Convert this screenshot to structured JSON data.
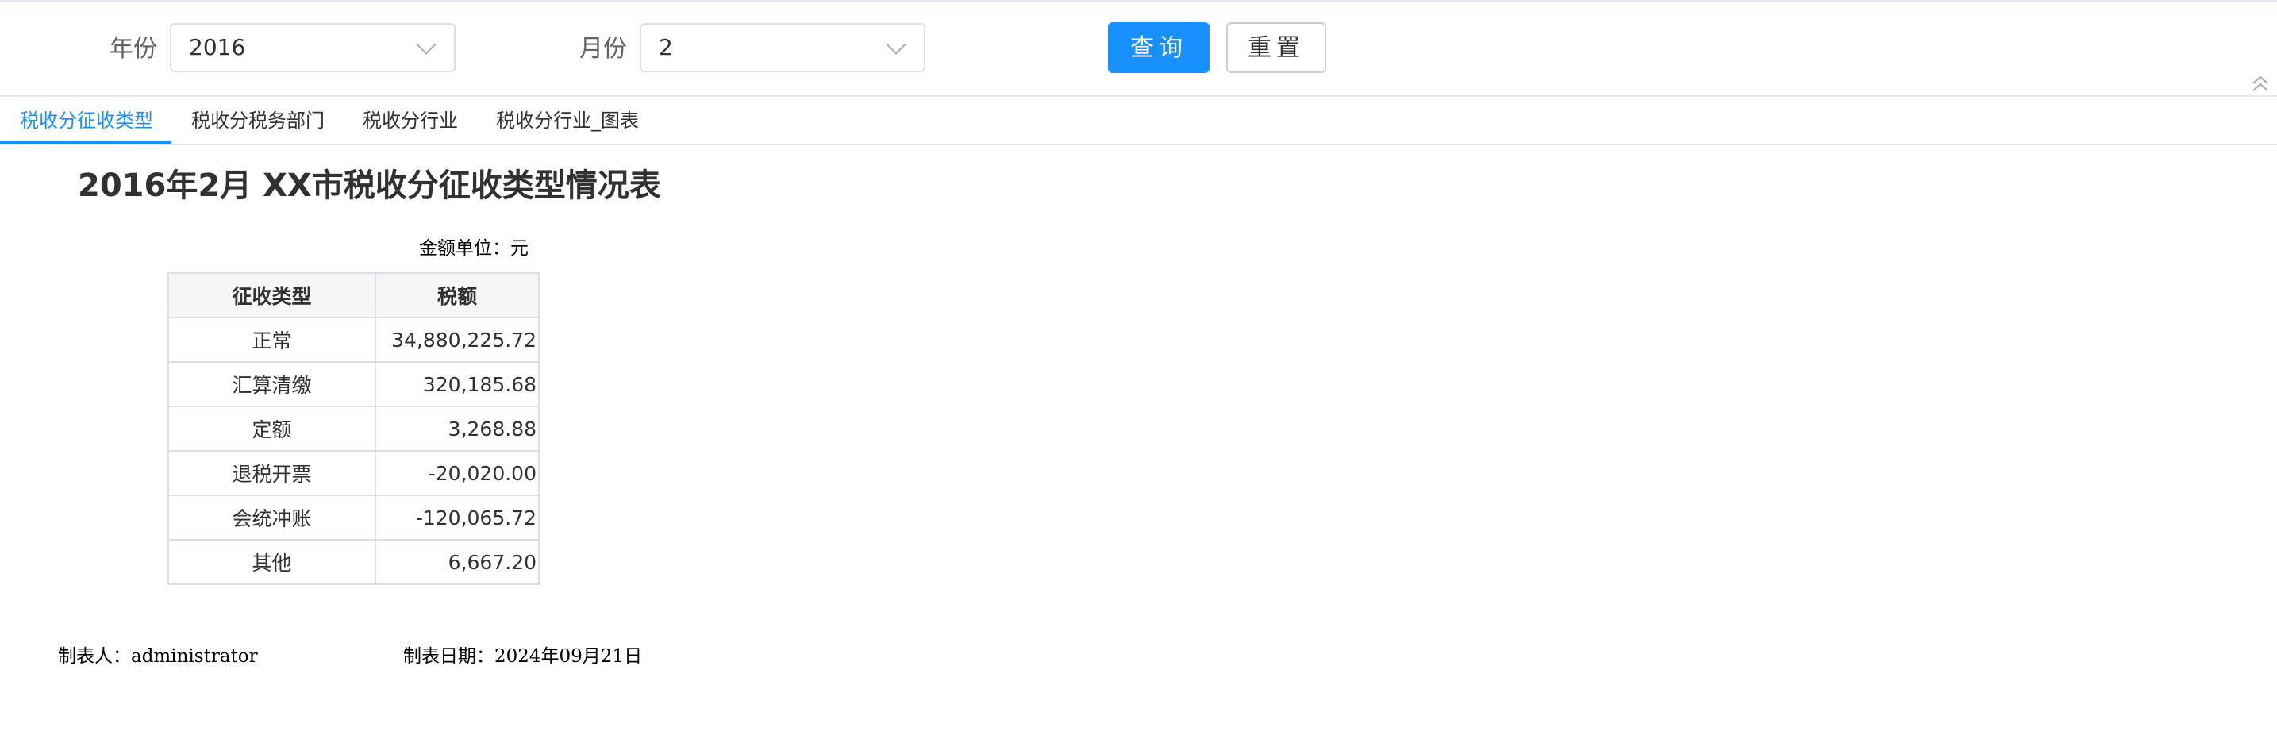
{
  "filters": {
    "year_label": "年份",
    "year_value": "2016",
    "month_label": "月份",
    "month_value": "2",
    "query_button": "查询",
    "reset_button": "重置"
  },
  "tabs": [
    {
      "label": "税收分征收类型",
      "active": true
    },
    {
      "label": "税收分税务部门",
      "active": false
    },
    {
      "label": "税收分行业",
      "active": false
    },
    {
      "label": "税收分行业_图表",
      "active": false
    }
  ],
  "report": {
    "title": "2016年2月 XX市税收分征收类型情况表",
    "unit_note": "金额单位：元",
    "columns": [
      "征收类型",
      "税额"
    ],
    "rows": [
      {
        "type": "正常",
        "amount": "34,880,225.72"
      },
      {
        "type": "汇算清缴",
        "amount": "320,185.68"
      },
      {
        "type": "定额",
        "amount": "3,268.88"
      },
      {
        "type": "退税开票",
        "amount": "-20,020.00"
      },
      {
        "type": "会统冲账",
        "amount": "-120,065.72"
      },
      {
        "type": "其他",
        "amount": "6,667.20"
      }
    ],
    "maker": "制表人：administrator",
    "date": "制表日期：2024年09月21日"
  },
  "colors": {
    "accent": "#1890ff",
    "border": "#dcdfe6",
    "header_bg": "#f4f6f8"
  },
  "icons": {
    "dropdown": "chevron-down-icon",
    "collapse": "double-chevron-up-icon"
  }
}
